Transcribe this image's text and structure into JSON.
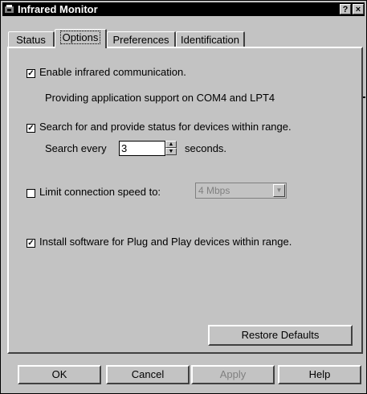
{
  "window": {
    "title": "Infrared Monitor"
  },
  "title_buttons": {
    "help": "?",
    "close": "×"
  },
  "tabs": [
    {
      "label": "Status"
    },
    {
      "label": "Options"
    },
    {
      "label": "Preferences"
    },
    {
      "label": "Identification"
    }
  ],
  "options": {
    "enable_ir": {
      "label": "Enable infrared communication.",
      "checked": true
    },
    "support_text": "Providing application support on COM4 and LPT4",
    "search": {
      "label": "Search for and provide status for devices within range.",
      "checked": true
    },
    "search_every_label": "Search every",
    "search_every_value": "3",
    "seconds_label": "seconds.",
    "limit_speed": {
      "label": "Limit connection speed to:",
      "checked": false
    },
    "speed_value": "4 Mbps",
    "install_pnp": {
      "label": "Install software for Plug and Play devices within range.",
      "checked": true
    },
    "restore_label": "Restore Defaults"
  },
  "buttons": {
    "ok": "OK",
    "cancel": "Cancel",
    "apply": "Apply",
    "help": "Help"
  },
  "icons": {
    "window": "infrared-monitor-icon",
    "check": "✓"
  }
}
